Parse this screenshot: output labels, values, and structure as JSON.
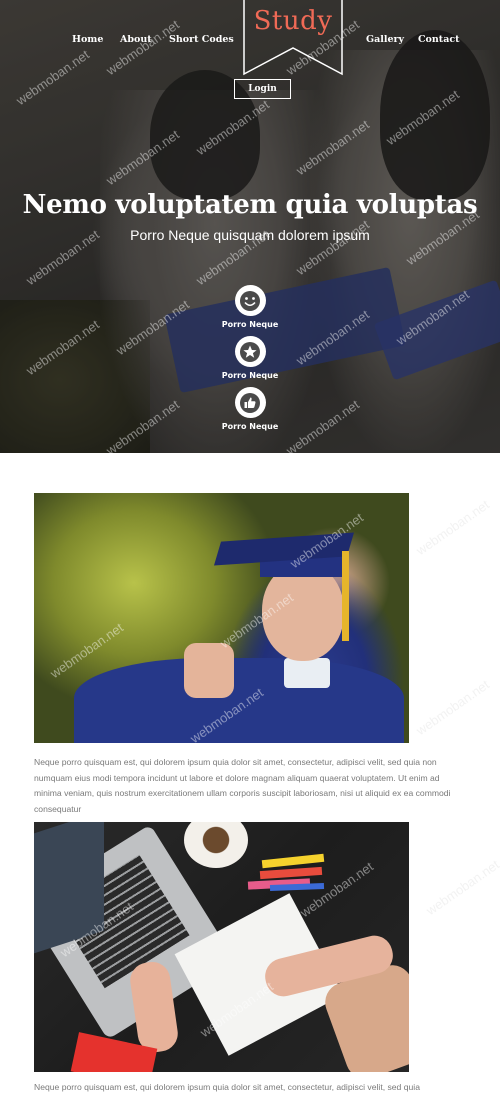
{
  "nav": {
    "home": "Home",
    "about": "About",
    "short_codes": "Short Codes",
    "gallery": "Gallery",
    "contact": "Contact",
    "logo": "Study",
    "login": "Login"
  },
  "hero": {
    "title": "Nemo voluptatem quia voluptas",
    "subtitle": "Porro Neque quisquam dolorem ipsum",
    "features": [
      {
        "icon": "smiley-icon",
        "label": "Porro Neque"
      },
      {
        "icon": "star-icon",
        "label": "Porro Neque"
      },
      {
        "icon": "thumbs-up-icon",
        "label": "Porro Neque"
      }
    ]
  },
  "content": {
    "paragraphs": [
      "Neque porro quisquam est, qui dolorem ipsum quia dolor sit amet, consectetur, adipisci velit, sed quia non numquam eius modi tempora incidunt ut labore et dolore magnam aliquam quaerat voluptatem. Ut enim ad minima veniam, quis nostrum exercitationem ullam corporis suscipit laboriosam, nisi ut aliquid ex ea commodi consequatur",
      "Neque porro quisquam est, qui dolorem ipsum quia dolor sit amet, consectetur, adipisci velit, sed quia"
    ]
  },
  "watermark": "webmoban.net",
  "colors": {
    "logo_accent": "#f06a56",
    "body_text": "#7a7a7a"
  }
}
